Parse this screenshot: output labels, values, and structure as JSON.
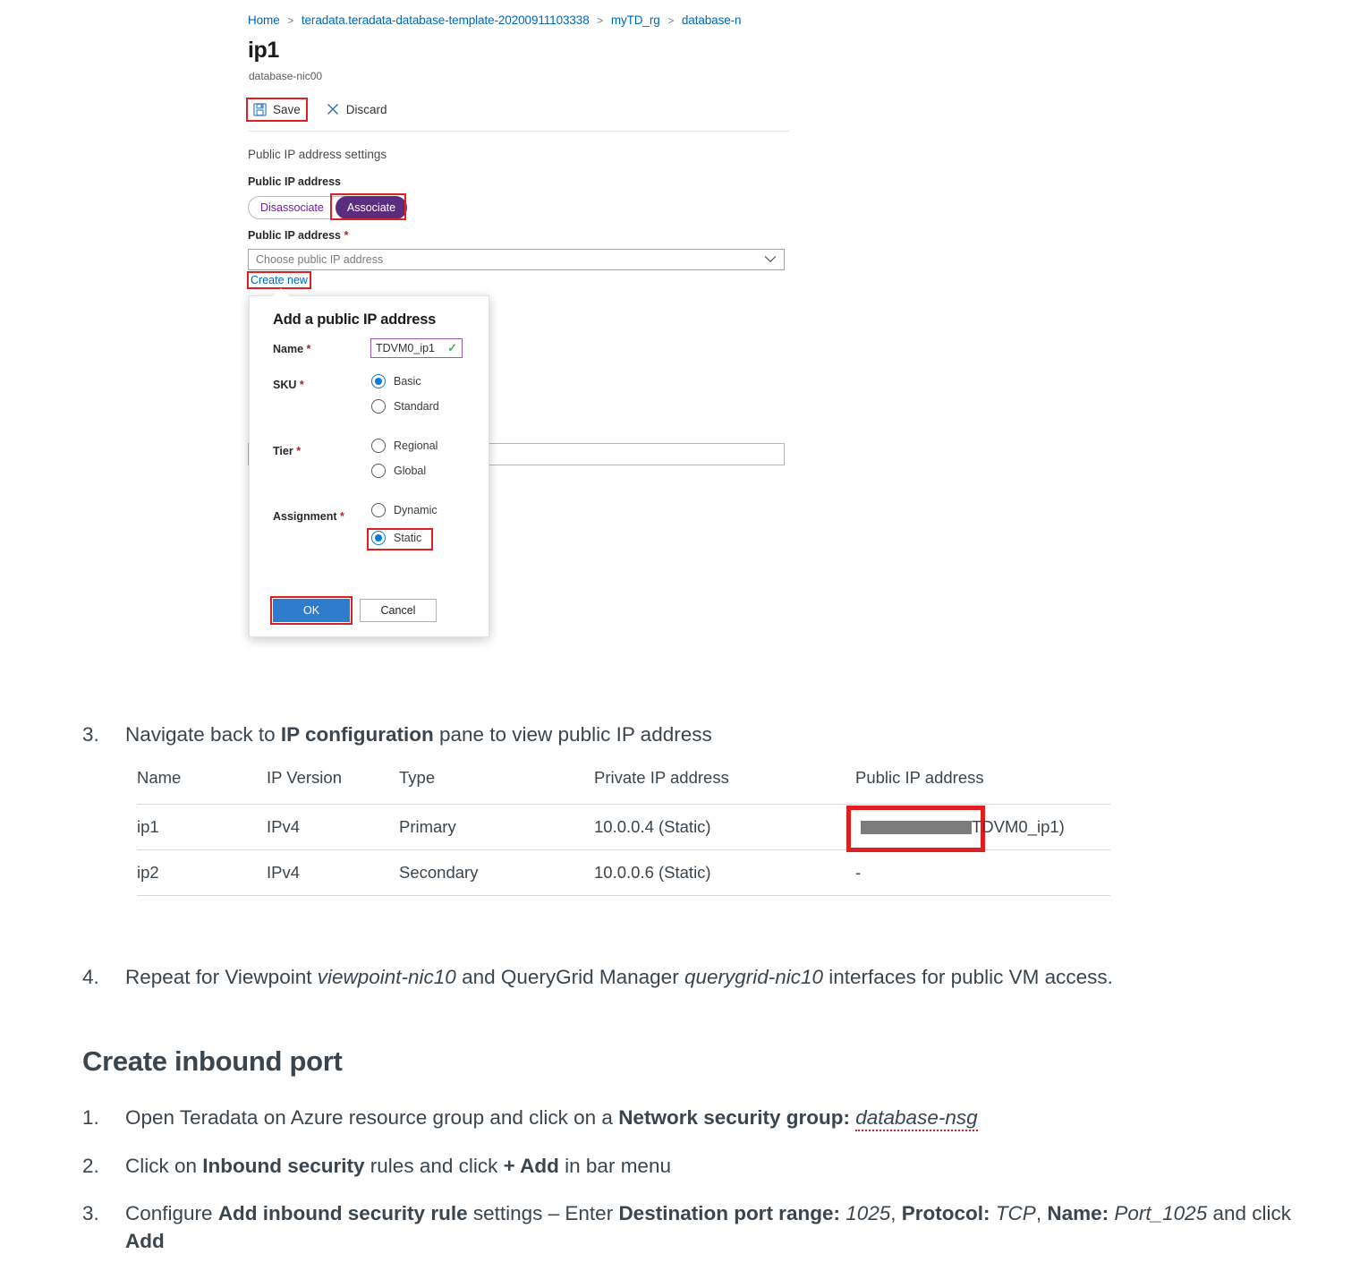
{
  "azure_screenshot": {
    "breadcrumb": {
      "name": "breadcrumb",
      "items": [
        "Home",
        "teradata.teradata-database-template-20200911103338",
        "myTD_rg",
        "database-n"
      ],
      "separator": ">"
    },
    "page_title": "ip1",
    "page_subtitle": "database-nic00",
    "command_bar": {
      "save_label": "Save",
      "save_icon": "save-disk-icon",
      "discard_label": "Discard",
      "discard_icon": "close-x-icon"
    },
    "section_label": "Public IP address settings",
    "toggle": {
      "label": "Public IP address",
      "options": [
        "Disassociate",
        "Associate"
      ],
      "selected": "Associate",
      "active_color": "#5c2d7c",
      "inactive_color": "#7719aa"
    },
    "public_ip_field": {
      "label": "Public IP address",
      "required_marker": "*",
      "placeholder": "Choose public IP address",
      "value": "",
      "chevron_icon": "chevron-down-icon",
      "create_new_link": "Create new"
    },
    "callout": {
      "title": "Add a public IP address",
      "name_field": {
        "label": "Name",
        "required_marker": "*",
        "value": "TDVM0_ip1",
        "valid_icon": "check-mark-icon",
        "border_color": "#9b59b6"
      },
      "sku": {
        "label": "SKU",
        "required_marker": "*",
        "options": [
          "Basic",
          "Standard"
        ],
        "selected": "Basic"
      },
      "tier": {
        "label": "Tier",
        "required_marker": "*",
        "options": [
          "Regional",
          "Global"
        ],
        "selected": ""
      },
      "assignment": {
        "label": "Assignment",
        "required_marker": "*",
        "options": [
          "Dynamic",
          "Static"
        ],
        "selected": "Static"
      },
      "ok_label": "OK",
      "cancel_label": "Cancel",
      "ok_color": "#2f7ccc"
    },
    "highlight_color": "#e02020"
  },
  "document": {
    "step3": {
      "number": "3.",
      "text_parts": [
        {
          "t": "Navigate back to ",
          "style": "normal"
        },
        {
          "t": "IP configuration",
          "style": "bold"
        },
        {
          "t": " pane to view public IP address",
          "style": "normal"
        }
      ]
    },
    "step4": {
      "number": "4.",
      "text_parts": [
        {
          "t": "Repeat for Viewpoint ",
          "style": "normal"
        },
        {
          "t": "viewpoint-nic10",
          "style": "italic"
        },
        {
          "t": " and QueryGrid Manager ",
          "style": "normal"
        },
        {
          "t": "querygrid-nic10",
          "style": "italic"
        },
        {
          "t": " interfaces for public VM access.",
          "style": "normal"
        }
      ]
    },
    "heading": "Create inbound port",
    "inbound_steps": [
      {
        "number": "1.",
        "text_parts": [
          {
            "t": "Open Teradata on Azure resource group and click on a ",
            "style": "normal"
          },
          {
            "t": "Network security group:",
            "style": "bold"
          },
          {
            "t": " ",
            "style": "normal"
          },
          {
            "t": "database-nsg",
            "style": "italic-spell"
          }
        ]
      },
      {
        "number": "2.",
        "text_parts": [
          {
            "t": "Click on ",
            "style": "normal"
          },
          {
            "t": "Inbound security",
            "style": "bold"
          },
          {
            "t": " rules and click ",
            "style": "normal"
          },
          {
            "t": "+ Add",
            "style": "bold"
          },
          {
            "t": " in bar menu",
            "style": "normal"
          }
        ]
      },
      {
        "number": "3.",
        "text_parts": [
          {
            "t": "Configure ",
            "style": "normal"
          },
          {
            "t": "Add inbound security rule",
            "style": "bold"
          },
          {
            "t": " settings – Enter ",
            "style": "normal"
          },
          {
            "t": "Destination port range:",
            "style": "bold"
          },
          {
            "t": " ",
            "style": "normal"
          },
          {
            "t": "1025",
            "style": "italic"
          },
          {
            "t": ", ",
            "style": "normal"
          },
          {
            "t": "Protocol:",
            "style": "bold"
          },
          {
            "t": " ",
            "style": "normal"
          },
          {
            "t": "TCP",
            "style": "italic"
          },
          {
            "t": ", ",
            "style": "normal"
          },
          {
            "t": "Name:",
            "style": "bold"
          },
          {
            "t": " ",
            "style": "normal"
          },
          {
            "t": "Port_1025",
            "style": "italic"
          },
          {
            "t": " and click ",
            "style": "normal"
          },
          {
            "t": "Add",
            "style": "bold"
          }
        ]
      }
    ]
  },
  "ip_table": {
    "headers": [
      "Name",
      "IP Version",
      "Type",
      "Private IP address",
      "Public IP address"
    ],
    "rows": [
      {
        "name": "ip1",
        "ip_version": "IPv4",
        "type": "Primary",
        "private_ip": "10.0.0.4 (Static)",
        "public_ip_redacted": true,
        "public_ip_suffix": "TDVM0_ip1)"
      },
      {
        "name": "ip2",
        "ip_version": "IPv4",
        "type": "Secondary",
        "private_ip": "10.0.0.6 (Static)",
        "public_ip_redacted": false,
        "public_ip_suffix": "-"
      }
    ]
  }
}
